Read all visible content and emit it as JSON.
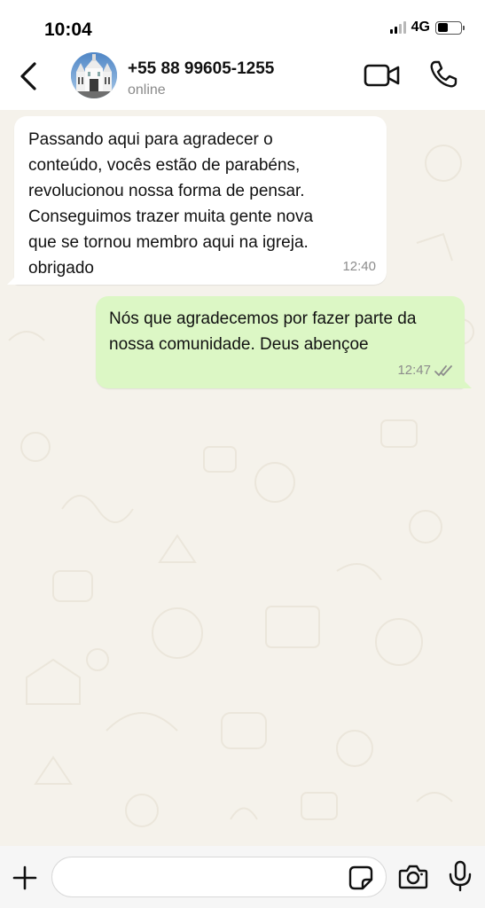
{
  "status_bar": {
    "time": "10:04",
    "network": "4G",
    "signal_bars_active": 2,
    "battery_level": 0.45
  },
  "header": {
    "contact_name": "+55 88 99605-1255",
    "contact_status": "online",
    "icons": {
      "back": "chevron-left-icon",
      "video": "video-camera-icon",
      "call": "phone-icon"
    }
  },
  "messages": [
    {
      "direction": "incoming",
      "text": "Passando aqui para agradecer o\nconteúdo, vocês estão de parabéns,\nrevolucionou nossa forma de pensar.\nConseguimos trazer muita gente nova\nque se tornou membro aqui na igreja.\nobrigado",
      "time": "12:40"
    },
    {
      "direction": "outgoing",
      "text": "Nós que agradecemos por fazer parte da\nnossa comunidade. Deus abençoe",
      "time": "12:47",
      "status": "read"
    }
  ],
  "input_bar": {
    "message_value": "",
    "icons": {
      "attach": "plus-icon",
      "sticker": "sticker-icon",
      "camera": "camera-icon",
      "mic": "microphone-icon"
    }
  },
  "colors": {
    "chat_background": "#f5f2eb",
    "incoming_bubble": "#ffffff",
    "outgoing_bubble": "#dcf7c5",
    "secondary_text": "#8a8a8a"
  }
}
